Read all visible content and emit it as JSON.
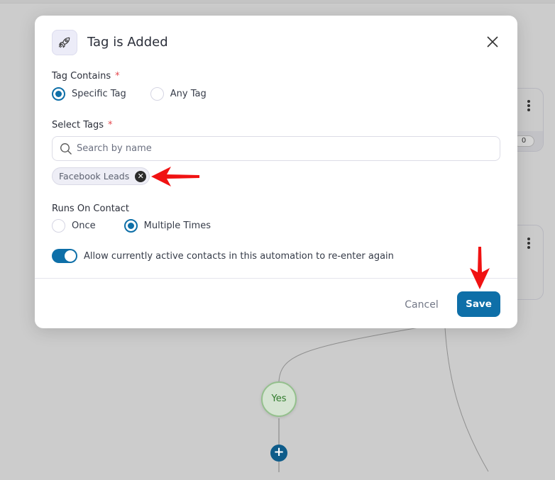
{
  "modal": {
    "title": "Tag is Added",
    "icon": "rocket-icon",
    "tag_contains": {
      "label": "Tag Contains",
      "required_mark": "*",
      "options": [
        {
          "label": "Specific Tag",
          "selected": true
        },
        {
          "label": "Any Tag",
          "selected": false
        }
      ]
    },
    "select_tags": {
      "label": "Select Tags",
      "required_mark": "*",
      "search_placeholder": "Search by name",
      "search_value": "",
      "selected_tags": [
        "Facebook Leads"
      ]
    },
    "runs_on_contact": {
      "label": "Runs On Contact",
      "options": [
        {
          "label": "Once",
          "selected": false
        },
        {
          "label": "Multiple Times",
          "selected": true
        }
      ]
    },
    "reenter_toggle": {
      "label": "Allow currently active contacts in this automation to re-enter again",
      "on": true
    },
    "footer": {
      "cancel_label": "Cancel",
      "save_label": "Save"
    }
  },
  "background": {
    "yes_node_label": "Yes",
    "card_count": "0",
    "accent_color": "#0e6fa8"
  }
}
